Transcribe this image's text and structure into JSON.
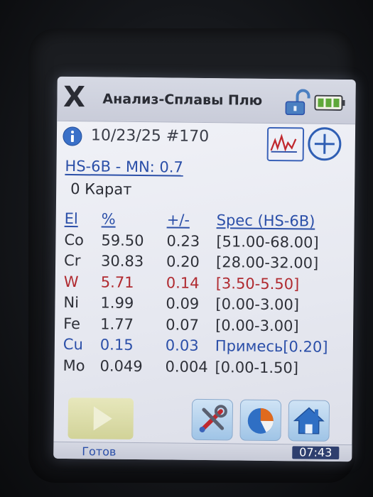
{
  "app": {
    "close_label": "X",
    "title": "Анализ-Сплавы Плю"
  },
  "header": {
    "datetime": "10/23/25 #170",
    "grade_line": "HS-6B - MN: 0.7",
    "karat": "0 Карат"
  },
  "table": {
    "columns": [
      "El",
      "%",
      "+/-",
      "Spec (HS-6B)"
    ],
    "rows": [
      {
        "el": "Co",
        "pct": "59.50",
        "err": "0.23",
        "spec": "[51.00-68.00]",
        "status": "normal"
      },
      {
        "el": "Cr",
        "pct": "30.83",
        "err": "0.20",
        "spec": "[28.00-32.00]",
        "status": "normal"
      },
      {
        "el": "W",
        "pct": "5.71",
        "err": "0.14",
        "spec": "[3.50-5.50]",
        "status": "warn"
      },
      {
        "el": "Ni",
        "pct": "1.99",
        "err": "0.09",
        "spec": "[0.00-3.00]",
        "status": "normal"
      },
      {
        "el": "Fe",
        "pct": "1.77",
        "err": "0.07",
        "spec": "[0.00-3.00]",
        "status": "normal"
      },
      {
        "el": "Cu",
        "pct": "0.15",
        "err": "0.03",
        "spec": "Примесь[0.20]",
        "status": "trace"
      },
      {
        "el": "Mo",
        "pct": "0.049",
        "err": "0.004",
        "spec": "[0.00-1.50]",
        "status": "normal"
      }
    ]
  },
  "statusbar": {
    "status": "Готов",
    "time": "07:43"
  },
  "colors": {
    "accent_blue": "#2b4fa8",
    "warn_red": "#b02a30",
    "text_dark": "#2e3038"
  },
  "icons": {
    "info": "info-icon",
    "lock": "unlocked-padlock-icon",
    "battery": "battery-icon",
    "chart": "line-chart-icon",
    "add": "plus-circle-icon",
    "play": "play-icon",
    "tools": "tools-icon",
    "pie": "pie-chart-icon",
    "home": "home-icon"
  }
}
